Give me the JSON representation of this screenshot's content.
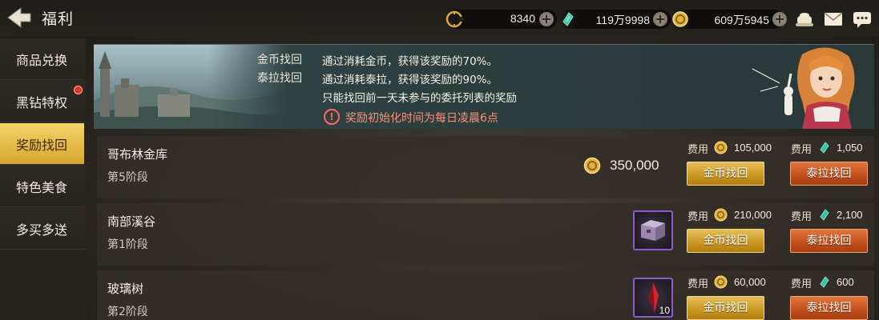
{
  "header": {
    "title": "福利",
    "currencies": [
      {
        "name": "c-token-icon",
        "value": "8340"
      },
      {
        "name": "green-gem-icon",
        "value": "119万9998"
      },
      {
        "name": "gold-coin-icon",
        "value": "609万5945"
      }
    ]
  },
  "sidebar": {
    "items": [
      {
        "label": "商品兑换",
        "active": false,
        "badge": false
      },
      {
        "label": "黑钻特权",
        "active": false,
        "badge": true
      },
      {
        "label": "奖励找回",
        "active": true,
        "badge": false
      },
      {
        "label": "特色美食",
        "active": false,
        "badge": false
      },
      {
        "label": "多买多送",
        "active": false,
        "badge": false
      }
    ]
  },
  "banner": {
    "lines": [
      {
        "label": "金币找回",
        "desc": "通过消耗金币，获得该奖励的70%。"
      },
      {
        "label": "泰拉找回",
        "desc": "通过消耗泰拉，获得该奖励的90%。"
      }
    ],
    "note": "只能找回前一天未参与的委托列表的奖励",
    "warning": "奖励初始化时间为每日凌晨6点",
    "warning_icon": "!"
  },
  "fee_label": "费用",
  "gold_button": "金币找回",
  "tera_button": "泰拉找回",
  "rows": [
    {
      "name": "哥布林金库",
      "stage": "第5阶段",
      "reward_type": "gold",
      "reward_amount": "350,000",
      "gold_cost": "105,000",
      "tera_cost": "1,050"
    },
    {
      "name": "南部溪谷",
      "stage": "第1阶段",
      "reward_type": "chest",
      "reward_count": "",
      "gold_cost": "210,000",
      "tera_cost": "2,100"
    },
    {
      "name": "玻璃树",
      "stage": "第2阶段",
      "reward_type": "crystal",
      "reward_count": "10",
      "gold_cost": "60,000",
      "tera_cost": "600"
    }
  ],
  "colors": {
    "active_tab": "#e8bf45",
    "gold_button": "#c9951f",
    "tera_button": "#c24e1b",
    "warning": "#ff6b5a",
    "item_border": "#8a5ccc"
  }
}
